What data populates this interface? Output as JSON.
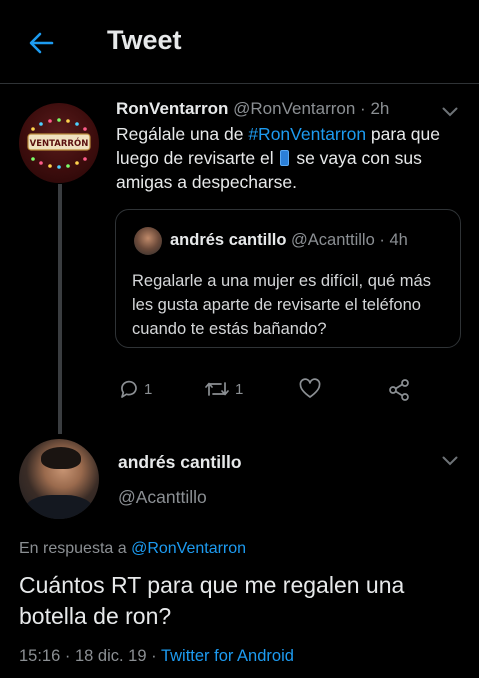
{
  "header": {
    "title": "Tweet"
  },
  "quoted_parent": {
    "author_name": "RonVentarron",
    "author_handle": "@RonVentarron",
    "time": "2h",
    "avatar_text": "VENTARRÓN",
    "text_before": "Regálale una de ",
    "hashtag": "#RonVentarron",
    "text_mid": " para que luego de revisarte el ",
    "text_after": " se vaya con sus amigas a despecharse.",
    "quote": {
      "author_name": "andrés cantillo",
      "author_handle": "@Acanttillo",
      "time": "4h",
      "text": "Regalarle a una mujer es difícil, qué más les gusta aparte de revisarte el teléfono cuando te estás bañando?"
    },
    "actions": {
      "reply_count": "1",
      "retweet_count": "1"
    }
  },
  "main_tweet": {
    "author_name": "andrés cantillo",
    "author_handle": "@Acanttillo",
    "reply_prefix": "En respuesta a ",
    "reply_to": "@RonVentarron",
    "text": "Cuántos RT para que me regalen una botella de ron?",
    "time": "15:16",
    "date": "18 dic. 19",
    "separator": "·",
    "source": "Twitter for Android"
  },
  "colors": {
    "accent": "#1d9bf0",
    "background": "#000000",
    "muted": "#8b8f93"
  }
}
